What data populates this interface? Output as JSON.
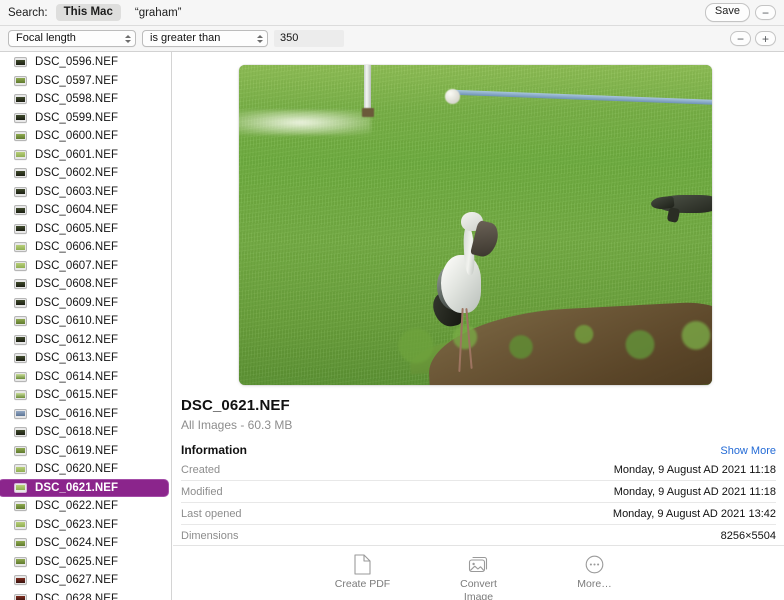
{
  "search": {
    "label": "Search:",
    "scopes": [
      "This Mac"
    ],
    "active_scope": "This Mac",
    "term": "“graham”",
    "save_label": "Save",
    "remove_label": "−"
  },
  "filter": {
    "attribute": "Focal length",
    "operator": "is greater than",
    "value": "350",
    "value_placeholder": "",
    "remove_label": "−",
    "add_label": "+"
  },
  "sidebar": {
    "files": [
      {
        "name": "DSC_0596.NEF",
        "thumb": "dark"
      },
      {
        "name": "DSC_0597.NEF",
        "thumb": "default"
      },
      {
        "name": "DSC_0598.NEF",
        "thumb": "dark"
      },
      {
        "name": "DSC_0599.NEF",
        "thumb": "dark"
      },
      {
        "name": "DSC_0600.NEF",
        "thumb": "default"
      },
      {
        "name": "DSC_0601.NEF",
        "thumb": "light"
      },
      {
        "name": "DSC_0602.NEF",
        "thumb": "dark"
      },
      {
        "name": "DSC_0603.NEF",
        "thumb": "dark"
      },
      {
        "name": "DSC_0604.NEF",
        "thumb": "dark"
      },
      {
        "name": "DSC_0605.NEF",
        "thumb": "dark"
      },
      {
        "name": "DSC_0606.NEF",
        "thumb": "light"
      },
      {
        "name": "DSC_0607.NEF",
        "thumb": "light"
      },
      {
        "name": "DSC_0608.NEF",
        "thumb": "dark"
      },
      {
        "name": "DSC_0609.NEF",
        "thumb": "dark"
      },
      {
        "name": "DSC_0610.NEF",
        "thumb": "default"
      },
      {
        "name": "DSC_0612.NEF",
        "thumb": "dark"
      },
      {
        "name": "DSC_0613.NEF",
        "thumb": "dark"
      },
      {
        "name": "DSC_0614.NEF",
        "thumb": "tall"
      },
      {
        "name": "DSC_0615.NEF",
        "thumb": "tall"
      },
      {
        "name": "DSC_0616.NEF",
        "thumb": "blue"
      },
      {
        "name": "DSC_0618.NEF",
        "thumb": "dark"
      },
      {
        "name": "DSC_0619.NEF",
        "thumb": "default"
      },
      {
        "name": "DSC_0620.NEF",
        "thumb": "light"
      },
      {
        "name": "DSC_0621.NEF",
        "thumb": "light",
        "selected": true
      },
      {
        "name": "DSC_0622.NEF",
        "thumb": "default"
      },
      {
        "name": "DSC_0623.NEF",
        "thumb": "light"
      },
      {
        "name": "DSC_0624.NEF",
        "thumb": "default"
      },
      {
        "name": "DSC_0625.NEF",
        "thumb": "default"
      },
      {
        "name": "DSC_0627.NEF",
        "thumb": "red"
      },
      {
        "name": "DSC_0628.NEF",
        "thumb": "red"
      }
    ]
  },
  "preview": {
    "image_alt": "Asian openbill stork standing on a green grass field with a monitor lizard at right",
    "filename": "DSC_0621.NEF",
    "subtitle": "All Images - 60.3 MB",
    "information_heading": "Information",
    "show_more": "Show More",
    "rows": [
      {
        "key": "Created",
        "value": "Monday, 9 August AD 2021 11:18"
      },
      {
        "key": "Modified",
        "value": "Monday, 9 August AD 2021 11:18"
      },
      {
        "key": "Last opened",
        "value": "Monday, 9 August AD 2021 13:42"
      },
      {
        "key": "Dimensions",
        "value": "8256×5504"
      }
    ]
  },
  "toolbar": {
    "actions": [
      {
        "label": "Create PDF",
        "icon": "document-icon"
      },
      {
        "label": "Convert\nImage",
        "icon": "photos-stack-icon"
      },
      {
        "label": "More…",
        "icon": "ellipsis-circle-icon"
      }
    ]
  },
  "colors": {
    "selection_purple": "#8b258c",
    "link_blue": "#246bd6",
    "chrome_grey": "#f6f6f6",
    "muted_text": "#8d8d8d"
  }
}
